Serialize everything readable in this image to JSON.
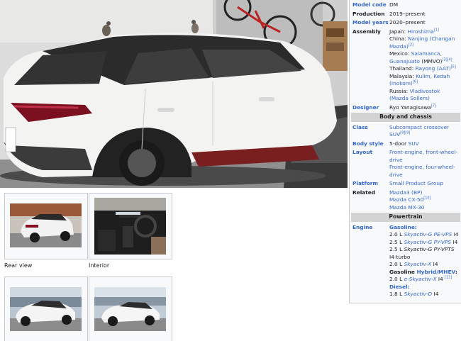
{
  "infobox": {
    "rows_top": [
      {
        "label": "Model code",
        "label_link": true,
        "lines": [
          [
            {
              "t": "DM"
            }
          ]
        ]
      },
      {
        "label": "Production",
        "label_link": false,
        "lines": [
          [
            {
              "t": "2019–present"
            }
          ]
        ]
      },
      {
        "label": "Model years",
        "label_link": true,
        "lines": [
          [
            {
              "t": "2020–present"
            }
          ]
        ]
      },
      {
        "label": "Assembly",
        "label_link": false,
        "lines": [
          [
            {
              "t": "Japan: "
            },
            {
              "t": "Hiroshima",
              "l": 1
            },
            {
              "t": "[1]",
              "s": 1
            }
          ],
          [
            {
              "t": "China: "
            },
            {
              "t": "Nanjing (Changan Mazda)",
              "l": 1
            },
            {
              "t": "[2]",
              "s": 1
            }
          ],
          [
            {
              "t": "Mexico: "
            },
            {
              "t": "Salamanca, Guanajuato",
              "l": 1
            },
            {
              "t": " (MMVO)"
            },
            {
              "t": "[3][4]",
              "s": 1
            }
          ],
          [
            {
              "t": "Thailand: "
            },
            {
              "t": "Rayong (AAT)",
              "l": 1
            },
            {
              "t": "[5]",
              "s": 1
            }
          ],
          [
            {
              "t": "Malaysia: "
            },
            {
              "t": "Kulim, Kedah (Inokom)",
              "l": 1
            },
            {
              "t": "[6]",
              "s": 1
            }
          ],
          [
            {
              "t": "Russia: "
            },
            {
              "t": "Vladivostok (Mazda Sollers)",
              "l": 1
            }
          ]
        ]
      },
      {
        "label": "Designer",
        "label_link": true,
        "lines": [
          [
            {
              "t": "Ryo Yanagisawa"
            },
            {
              "t": "[7]",
              "s": 1
            }
          ]
        ]
      }
    ],
    "header_body": "Body and chassis",
    "rows_body": [
      {
        "label": "Class",
        "label_link": true,
        "lines": [
          [
            {
              "t": "Subcompact crossover SUV",
              "l": 1
            },
            {
              "t": "[8][9]",
              "s": 1
            }
          ]
        ]
      },
      {
        "label": "Body style",
        "label_link": true,
        "lines": [
          [
            {
              "t": "5-door "
            },
            {
              "t": "SUV",
              "l": 1
            }
          ]
        ]
      },
      {
        "label": "Layout",
        "label_link": true,
        "lines": [
          [
            {
              "t": "Front-engine, front-wheel-drive",
              "l": 1
            }
          ],
          [
            {
              "t": "Front-engine, four-wheel-drive",
              "l": 1
            }
          ]
        ]
      },
      {
        "label": "Platform",
        "label_link": true,
        "lines": [
          [
            {
              "t": "Small Product Group",
              "l": 1
            }
          ]
        ]
      },
      {
        "label": "Related",
        "label_link": false,
        "lines": [
          [
            {
              "t": "Mazda3 (BP)",
              "l": 1
            }
          ],
          [
            {
              "t": "Mazda CX-50",
              "l": 1
            },
            {
              "t": "[10]",
              "s": 1
            }
          ],
          [
            {
              "t": "Mazda MX-30",
              "l": 1
            }
          ]
        ]
      }
    ],
    "header_power": "Powertrain",
    "rows_power": [
      {
        "label": "Engine",
        "label_link": true,
        "lines": [
          [
            {
              "t": "Gasoline:",
              "l": 1,
              "b": 1
            }
          ],
          [
            {
              "t": "2.0 L "
            },
            {
              "t": "Skyactiv-G PE-VPS",
              "l": 1,
              "i": 1
            },
            {
              "t": " I4"
            }
          ],
          [
            {
              "t": "2.5 L "
            },
            {
              "t": "Skyactiv-G PY-VPS",
              "l": 1,
              "i": 1
            },
            {
              "t": " I4"
            }
          ],
          [
            {
              "t": "2.5 L "
            },
            {
              "t": "Skyactiv-G PY-VPTS",
              "i": 1
            },
            {
              "t": " I4-turbo"
            }
          ],
          [
            {
              "t": "2.0 L "
            },
            {
              "t": "Skyactiv-X",
              "l": 1,
              "i": 1
            },
            {
              "t": " I4"
            }
          ],
          [
            {
              "t": "Gasoline ",
              "b": 1
            },
            {
              "t": "Hybrid/MHEV",
              "l": 1,
              "b": 1
            },
            {
              "t": ":",
              "b": 1
            }
          ],
          [
            {
              "t": "2.0 L "
            },
            {
              "t": "e-Skyactiv-X",
              "l": 1,
              "i": 1
            },
            {
              "t": " I4 "
            },
            {
              "t": "[11]",
              "s": 1
            }
          ],
          [
            {
              "t": "Diesel:",
              "l": 1,
              "b": 1
            }
          ],
          [
            {
              "t": "1.8 L "
            },
            {
              "t": "Skyactiv-D",
              "l": 1,
              "i": 1
            },
            {
              "t": " I4"
            }
          ]
        ]
      }
    ]
  },
  "gallery": {
    "captions": [
      "Rear view",
      "Interior"
    ]
  },
  "colors": {
    "link": "#3366cc",
    "header_bg": "#d3d3d3",
    "infobox_bg": "#f8f9fa",
    "car_body": "#f3f3f1"
  }
}
